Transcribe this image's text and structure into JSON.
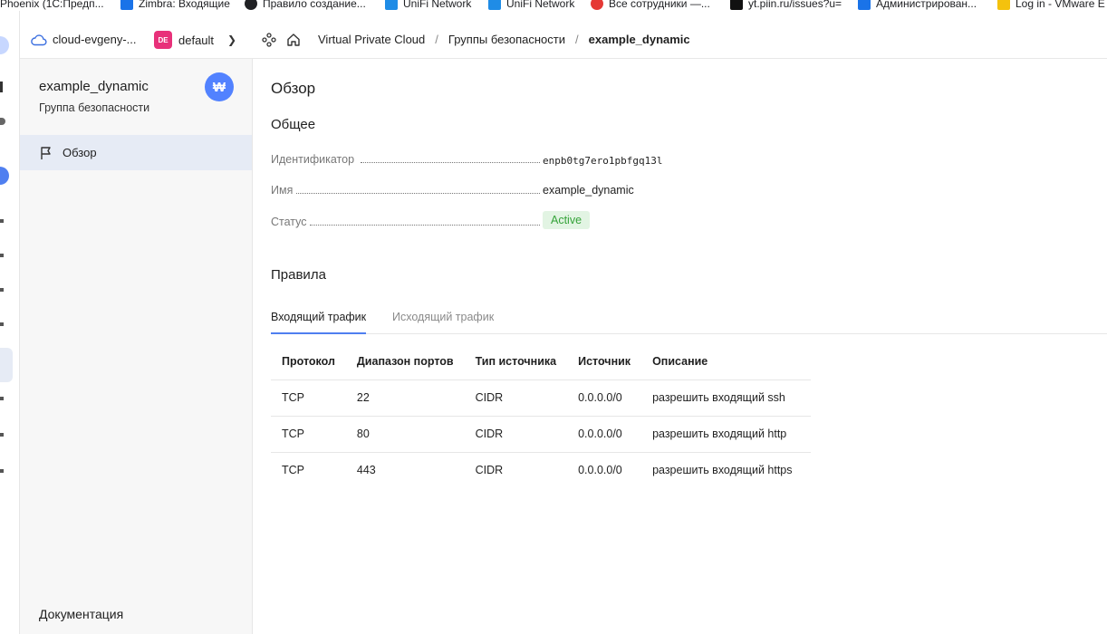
{
  "bookmarks": [
    {
      "label": "Phoenix (1С:Предп...",
      "icon": "phoenix-icon"
    },
    {
      "label": "Zimbra: Входящие",
      "icon": "zimbra-icon"
    },
    {
      "label": "Правило создание...",
      "icon": "globe-icon"
    },
    {
      "label": "UniFi Network",
      "icon": "unifi-icon"
    },
    {
      "label": "UniFi Network",
      "icon": "unifi-icon"
    },
    {
      "label": "Все сотрудники —...",
      "icon": "yandex-icon"
    },
    {
      "label": "yt.piin.ru/issues?u=",
      "icon": "youtrack-icon"
    },
    {
      "label": "Администрирован...",
      "icon": "zimbra-icon"
    },
    {
      "label": "Log in - VMware E",
      "icon": "vmware-icon"
    }
  ],
  "header": {
    "cloud": "cloud-evgeny-...",
    "folder_badge": "DE",
    "folder": "default",
    "breadcrumbs": [
      "Virtual Private Cloud",
      "Группы безопасности",
      "example_dynamic"
    ]
  },
  "sidebar": {
    "title": "example_dynamic",
    "subtitle": "Группа безопасности",
    "items": [
      {
        "label": "Обзор",
        "icon": "flag-icon"
      }
    ],
    "footer_link": "Документация"
  },
  "main": {
    "page_title": "Обзор",
    "general_heading": "Общее",
    "fields": {
      "id_label": "Идентификатор",
      "id_value": "enpb0tg7ero1pbfgq13l",
      "name_label": "Имя",
      "name_value": "example_dynamic",
      "status_label": "Статус",
      "status_value": "Active"
    },
    "rules_heading": "Правила",
    "tabs": [
      "Входящий трафик",
      "Исходящий трафик"
    ],
    "table": {
      "columns": [
        "Протокол",
        "Диапазон портов",
        "Тип источника",
        "Источник",
        "Описание"
      ],
      "rows": [
        [
          "TCP",
          "22",
          "CIDR",
          "0.0.0.0/0",
          "разрешить входящий ssh"
        ],
        [
          "TCP",
          "80",
          "CIDR",
          "0.0.0.0/0",
          "разрешить входящий http"
        ],
        [
          "TCP",
          "443",
          "CIDR",
          "0.0.0.0/0",
          "разрешить входящий https"
        ]
      ]
    }
  },
  "colors": {
    "accent": "#4f7ff0",
    "status_active_bg": "#e2f4e3",
    "status_active_text": "#35a339",
    "folder_badge": "#e8317a"
  }
}
